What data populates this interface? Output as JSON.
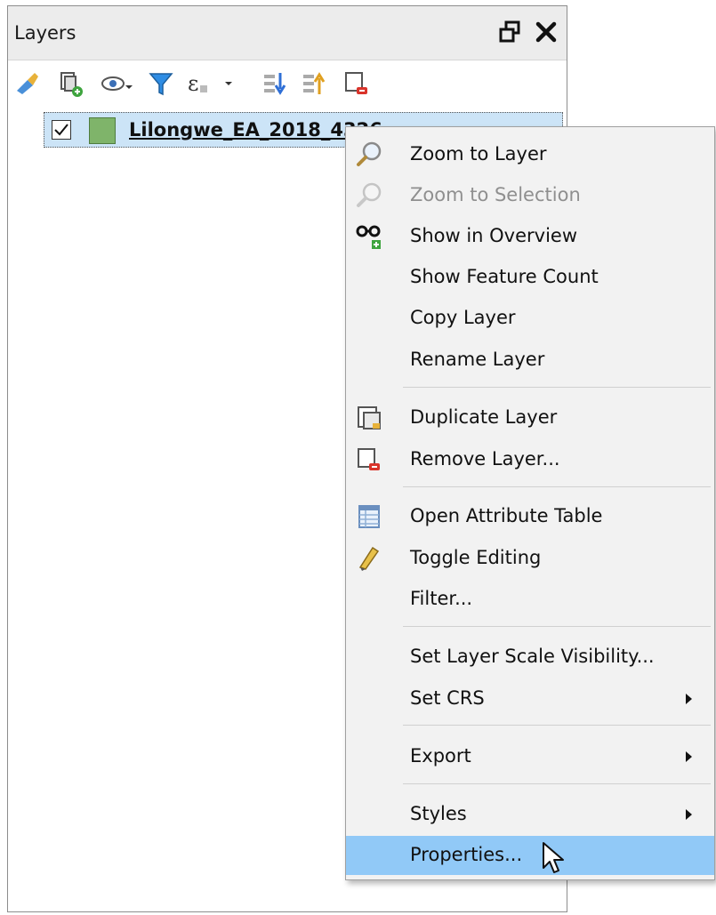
{
  "panel": {
    "title": "Layers",
    "float_icon": "float-window-icon",
    "close_icon": "close-icon"
  },
  "toolbar": {
    "icons": [
      "open-layer-styling-icon",
      "add-group-icon",
      "manage-map-themes-icon",
      "filter-legend-icon",
      "filter-by-expression-icon",
      "expand-all-icon",
      "collapse-all-icon",
      "remove-layer-icon"
    ]
  },
  "layer": {
    "name": "Lilongwe_EA_2018_4326",
    "checked": true,
    "swatch_color": "#7fb46a"
  },
  "context_menu": {
    "items": [
      {
        "label": "Zoom to Layer",
        "icon": "zoom-icon",
        "enabled": true
      },
      {
        "label": "Zoom to Selection",
        "icon": "zoom-icon",
        "enabled": false
      },
      {
        "label": "Show in Overview",
        "icon": "overview-glasses-icon",
        "enabled": true
      },
      {
        "label": "Show Feature Count",
        "enabled": true
      },
      {
        "label": "Copy Layer",
        "enabled": true
      },
      {
        "label": "Rename Layer",
        "enabled": true
      },
      {
        "label": "Duplicate Layer",
        "icon": "duplicate-layer-icon",
        "enabled": true
      },
      {
        "label": "Remove Layer...",
        "icon": "remove-layer-icon",
        "enabled": true
      },
      {
        "label": "Open Attribute Table",
        "icon": "attribute-table-icon",
        "enabled": true
      },
      {
        "label": "Toggle Editing",
        "icon": "pencil-icon",
        "enabled": true
      },
      {
        "label": "Filter...",
        "enabled": true
      },
      {
        "label": "Set Layer Scale Visibility...",
        "enabled": true
      },
      {
        "label": "Set CRS",
        "submenu": true,
        "enabled": true
      },
      {
        "label": "Export",
        "submenu": true,
        "enabled": true
      },
      {
        "label": "Styles",
        "submenu": true,
        "enabled": true
      },
      {
        "label": "Properties...",
        "enabled": true,
        "highlighted": true
      }
    ]
  },
  "colors": {
    "selection": "#cce4f7",
    "menu_highlight": "#91c9f7",
    "menu_background": "#f2f2f2"
  }
}
